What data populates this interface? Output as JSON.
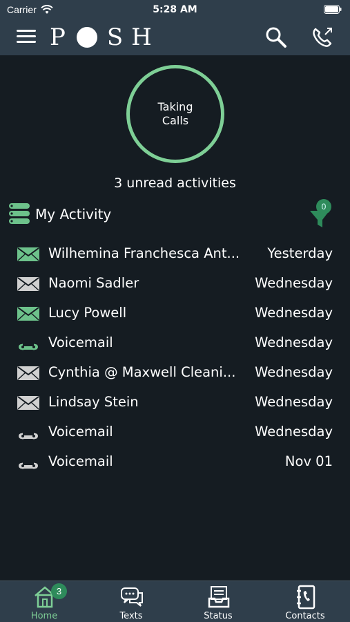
{
  "statusbar": {
    "carrier": "Carrier",
    "time": "5:28 AM"
  },
  "navbar": {
    "logo": "POSH"
  },
  "status_ring": {
    "label": "Taking Calls",
    "color": "#7ecf96"
  },
  "unread_text": "3 unread activities",
  "activity": {
    "title": "My Activity",
    "filter_count": "0",
    "rows": [
      {
        "icon": "envelope-icon",
        "unread": true,
        "name": "Wilhemina Franchesca Ant...",
        "date": "Yesterday"
      },
      {
        "icon": "envelope-icon",
        "unread": false,
        "name": "Naomi Sadler",
        "date": "Wednesday"
      },
      {
        "icon": "envelope-icon",
        "unread": true,
        "name": "Lucy Powell",
        "date": "Wednesday"
      },
      {
        "icon": "voicemail-icon",
        "unread": true,
        "name": "Voicemail",
        "date": "Wednesday"
      },
      {
        "icon": "envelope-icon",
        "unread": false,
        "name": "Cynthia @ Maxwell Cleani...",
        "date": "Wednesday"
      },
      {
        "icon": "envelope-icon",
        "unread": false,
        "name": "Lindsay Stein",
        "date": "Wednesday"
      },
      {
        "icon": "voicemail-icon",
        "unread": false,
        "name": "Voicemail",
        "date": "Wednesday"
      },
      {
        "icon": "voicemail-icon",
        "unread": false,
        "name": "Voicemail",
        "date": "Nov 01"
      }
    ]
  },
  "tabs": [
    {
      "label": "Home",
      "icon": "home-icon",
      "active": true,
      "badge": "3"
    },
    {
      "label": "Texts",
      "icon": "texts-icon",
      "active": false
    },
    {
      "label": "Status",
      "icon": "status-icon",
      "active": false
    },
    {
      "label": "Contacts",
      "icon": "contacts-icon",
      "active": false
    }
  ],
  "colors": {
    "accent": "#7ecf96",
    "unread_icon": "#6dc28b",
    "read_icon": "#d0d0d0",
    "background": "#151c22",
    "bar": "#2f3e4b",
    "badge": "#2e8b5b"
  }
}
